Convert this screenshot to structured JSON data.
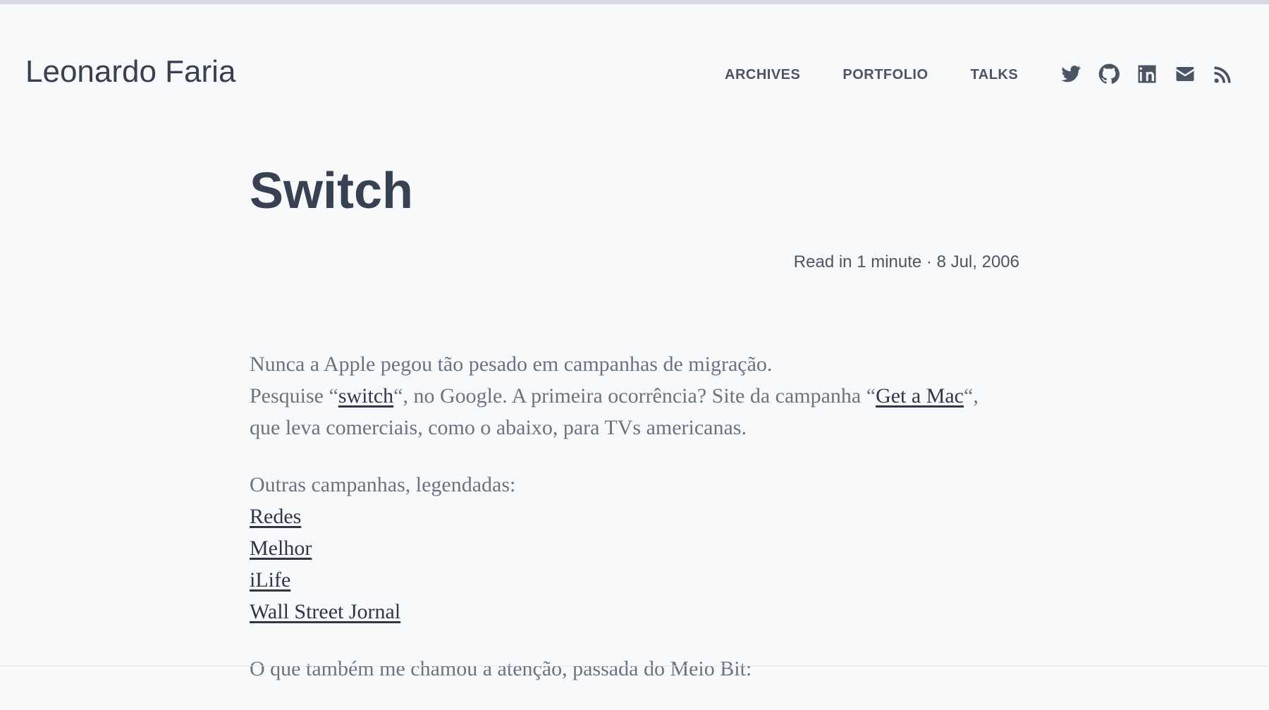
{
  "header": {
    "site_title": "Leonardo Faria",
    "nav": {
      "archives": "ARCHIVES",
      "portfolio": "PORTFOLIO",
      "talks": "TALKS"
    },
    "social_icons": [
      "twitter-icon",
      "github-icon",
      "linkedin-icon",
      "email-icon",
      "rss-icon"
    ]
  },
  "post": {
    "title": "Switch",
    "meta": "Read in 1 minute · 8 Jul, 2006",
    "paragraph1": {
      "line1": "Nunca a Apple pegou tão pesado em campanhas de migração.",
      "part1": "Pesquise “",
      "link_switch": "switch",
      "part2": "“, no Google. A primeira ocorrência? Site da campanha “",
      "link_get_a_mac": "Get a Mac",
      "part3": "“, que leva comerciais, como o abaixo, para TVs americanas."
    },
    "paragraph2": {
      "intro": "Outras campanhas, legendadas:",
      "links": [
        "Redes",
        "Melhor",
        "iLife",
        "Wall Street Jornal"
      ]
    },
    "paragraph3": "O que também me chamou a atenção, passada do Meio Bit:"
  },
  "colors": {
    "background": "#f8f9fb",
    "text": "#374151",
    "muted": "#6b7280",
    "link": "#2d3748"
  }
}
